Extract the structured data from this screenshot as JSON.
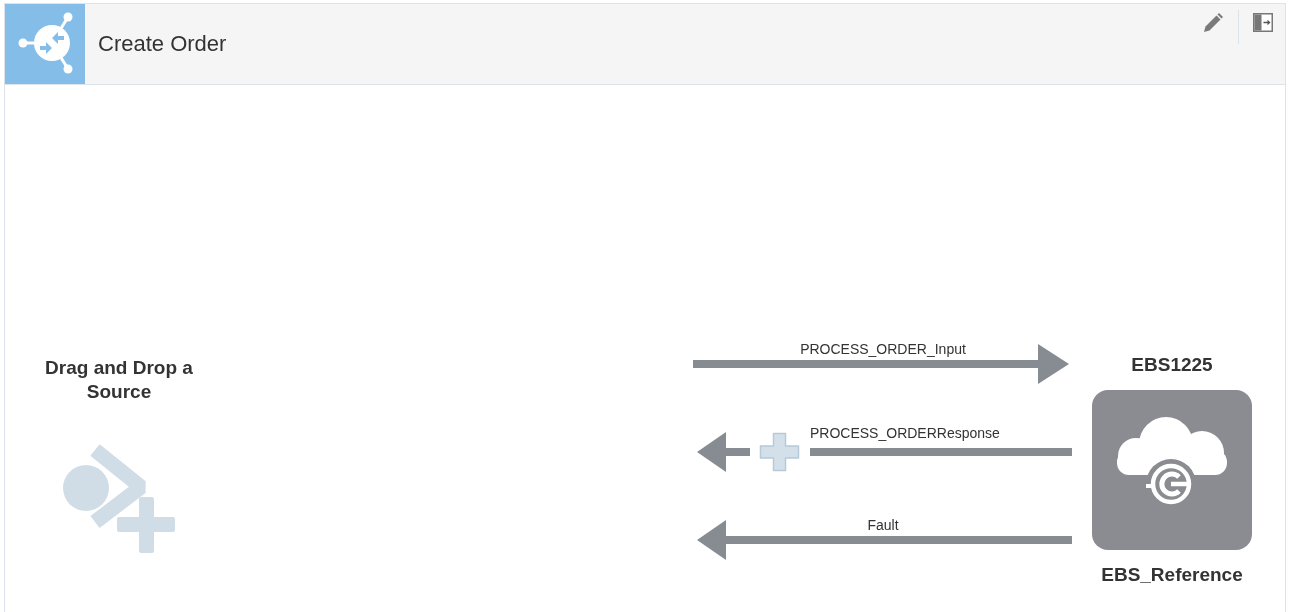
{
  "header": {
    "title": "Create Order"
  },
  "source": {
    "label": "Drag and Drop a Source"
  },
  "flows": [
    {
      "label": "PROCESS_ORDER_Input",
      "kind": "outgoing",
      "add_point": false
    },
    {
      "label": "PROCESS_ORDERResponse",
      "kind": "incoming",
      "add_point": true
    },
    {
      "label": "Fault",
      "kind": "incoming",
      "add_point": false
    }
  ],
  "target": {
    "name": "EBS1225",
    "label": "EBS_Reference"
  }
}
